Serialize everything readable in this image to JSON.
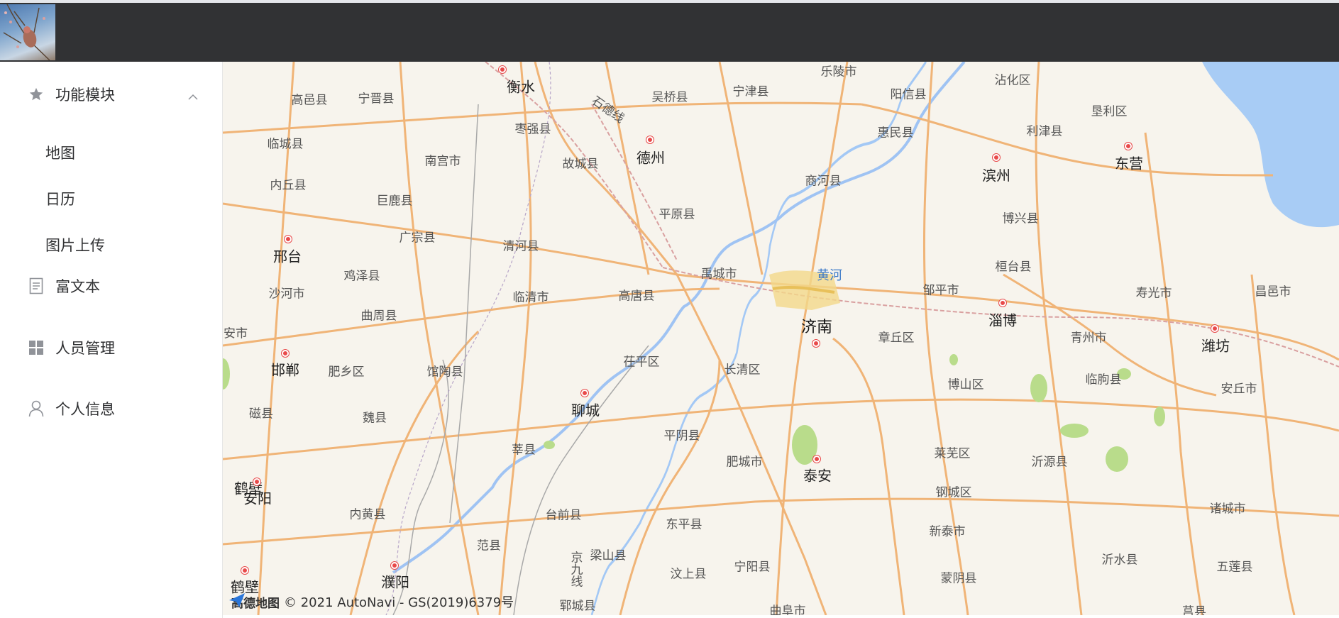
{
  "header": {},
  "sidebar": {
    "groups": [
      {
        "label": "功能模块",
        "icon": "star-icon",
        "expanded": true,
        "children": [
          {
            "label": "地图"
          },
          {
            "label": "日历"
          },
          {
            "label": "图片上传"
          }
        ]
      },
      {
        "label": "富文本",
        "icon": "document-icon"
      },
      {
        "label": "人员管理",
        "icon": "grid-icon"
      },
      {
        "label": "个人信息",
        "icon": "user-icon"
      }
    ]
  },
  "map": {
    "attribution_logo": "高德地图",
    "attribution": "© 2021 AutoNavi - GS(2019)6379号",
    "places": [
      {
        "name": "衡水",
        "major": true
      },
      {
        "name": "德州",
        "major": true
      },
      {
        "name": "滨州",
        "major": true
      },
      {
        "name": "东营",
        "major": true
      },
      {
        "name": "邢台",
        "major": true
      },
      {
        "name": "济南",
        "major": true
      },
      {
        "name": "淄博",
        "major": true
      },
      {
        "name": "潍坊",
        "major": true
      },
      {
        "name": "邯郸",
        "major": true
      },
      {
        "name": "聊城",
        "major": true
      },
      {
        "name": "泰安",
        "major": true
      },
      {
        "name": "安阳",
        "major": true
      },
      {
        "name": "濮阳",
        "major": true
      },
      {
        "name": "鹤壁",
        "major": true
      },
      {
        "name": "黄河",
        "river": true
      },
      {
        "name": "高邑县"
      },
      {
        "name": "宁晋县"
      },
      {
        "name": "吴桥县"
      },
      {
        "name": "宁津县"
      },
      {
        "name": "乐陵市"
      },
      {
        "name": "阳信县"
      },
      {
        "name": "沾化区"
      },
      {
        "name": "垦利区"
      },
      {
        "name": "利津县"
      },
      {
        "name": "临城县"
      },
      {
        "name": "枣强县"
      },
      {
        "name": "惠民县"
      },
      {
        "name": "内丘县"
      },
      {
        "name": "南宫市"
      },
      {
        "name": "故城县"
      },
      {
        "name": "巨鹿县"
      },
      {
        "name": "商河县"
      },
      {
        "name": "平原县"
      },
      {
        "name": "广宗县"
      },
      {
        "name": "博兴县"
      },
      {
        "name": "清河县"
      },
      {
        "name": "桓台县"
      },
      {
        "name": "鸡泽县"
      },
      {
        "name": "禹城市"
      },
      {
        "name": "沙河市"
      },
      {
        "name": "临清市"
      },
      {
        "name": "高唐县"
      },
      {
        "name": "邹平市"
      },
      {
        "name": "寿光市"
      },
      {
        "name": "昌邑市"
      },
      {
        "name": "曲周县"
      },
      {
        "name": "章丘区"
      },
      {
        "name": "青州市"
      },
      {
        "name": "安市"
      },
      {
        "name": "茌平区"
      },
      {
        "name": "肥乡区"
      },
      {
        "name": "馆陶县"
      },
      {
        "name": "长清区"
      },
      {
        "name": "博山区"
      },
      {
        "name": "临朐县"
      },
      {
        "name": "安丘市"
      },
      {
        "name": "磁县"
      },
      {
        "name": "魏县"
      },
      {
        "name": "平阴县"
      },
      {
        "name": "莘县"
      },
      {
        "name": "肥城市"
      },
      {
        "name": "莱芜区"
      },
      {
        "name": "沂源县"
      },
      {
        "name": "钢城区"
      },
      {
        "name": "内黄县"
      },
      {
        "name": "台前县"
      },
      {
        "name": "东平县"
      },
      {
        "name": "新泰市"
      },
      {
        "name": "诸城市"
      },
      {
        "name": "范县"
      },
      {
        "name": "梁山县"
      },
      {
        "name": "宁阳县"
      },
      {
        "name": "汶上县"
      },
      {
        "name": "沂水县"
      },
      {
        "name": "五莲县"
      },
      {
        "name": "蒙阴县"
      },
      {
        "name": "郓城县"
      },
      {
        "name": "曲阜市"
      },
      {
        "name": "莒县"
      },
      {
        "name": "石德线"
      },
      {
        "name": "京九线"
      }
    ]
  }
}
